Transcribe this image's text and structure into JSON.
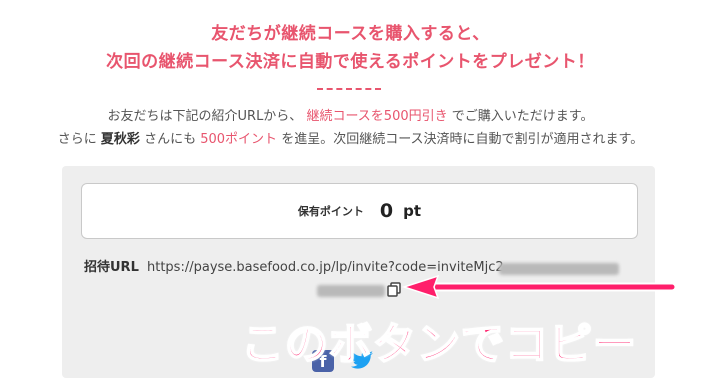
{
  "headline": {
    "line1": "友だちが継続コースを購入すると、",
    "line2": "次回の継続コース決済に自動で使えるポイントをプレゼント！"
  },
  "description": {
    "line1_pre": "お友だちは下記の紹介URLから、",
    "line1_highlight": "継続コースを500円引き",
    "line1_post": "でご購入いただけます。",
    "line2_pre": "さらに",
    "line2_name": "夏秋彩",
    "line2_mid": "さんにも",
    "line2_highlight": "500ポイント",
    "line2_post": "を進呈。次回継続コース決済時に自動で割引が適用されます。"
  },
  "points": {
    "label": "保有ポイント",
    "value": "0",
    "unit": "pt"
  },
  "invite": {
    "label": "招待URL",
    "url_visible": "https://payse.basefood.co.jp/lp/invite?code=inviteMjc2"
  },
  "annotation": {
    "text": "このボタンでコピー"
  },
  "icons": {
    "copy": "copy-icon",
    "facebook": "facebook-icon",
    "twitter": "twitter-icon"
  },
  "colors": {
    "accent": "#e8556e",
    "annotation": "#ff1f6b",
    "panel_bg": "#eeeeee"
  }
}
